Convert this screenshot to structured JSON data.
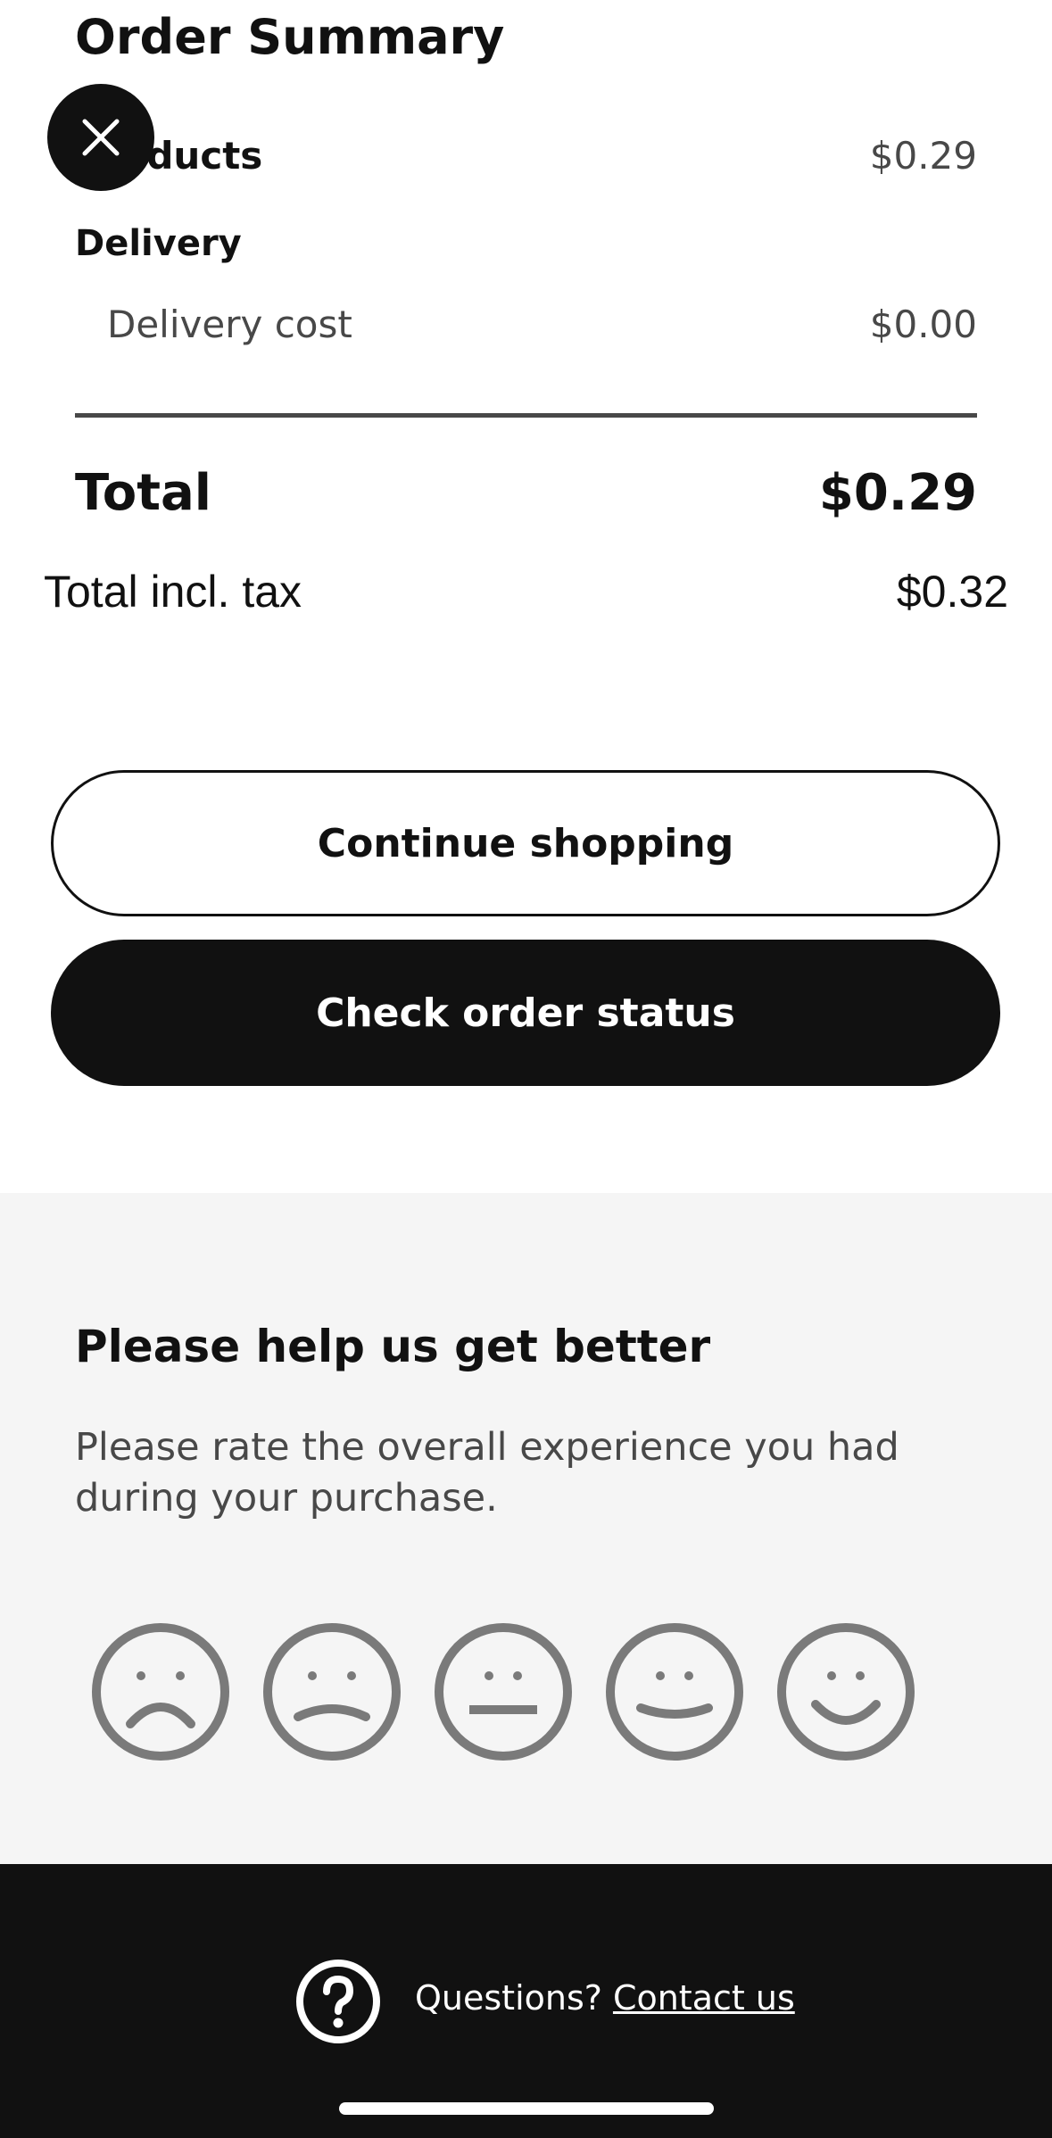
{
  "summary": {
    "title": "Order Summary",
    "products_label": "Products",
    "products_value": "$0.29",
    "delivery_label": "Delivery",
    "delivery_cost_label": "Delivery cost",
    "delivery_cost_value": "$0.00",
    "total_label": "Total",
    "total_value": "$0.29",
    "tax_label": "Total incl. tax",
    "tax_value": "$0.32"
  },
  "actions": {
    "continue_label": "Continue shopping",
    "check_status_label": "Check order status"
  },
  "feedback": {
    "title": "Please help us get better",
    "text": "Please rate the overall experience you had during your purchase.",
    "ratings": [
      "very-sad-face-icon",
      "sad-face-icon",
      "neutral-face-icon",
      "smile-face-icon",
      "happy-face-icon"
    ]
  },
  "footer": {
    "question": "Questions?",
    "contact_label": "Contact us"
  },
  "colors": {
    "primary": "#111111",
    "feedback_bg": "#f5f5f5",
    "secondary_text": "#484848",
    "face_gray": "#7a7a7a"
  }
}
